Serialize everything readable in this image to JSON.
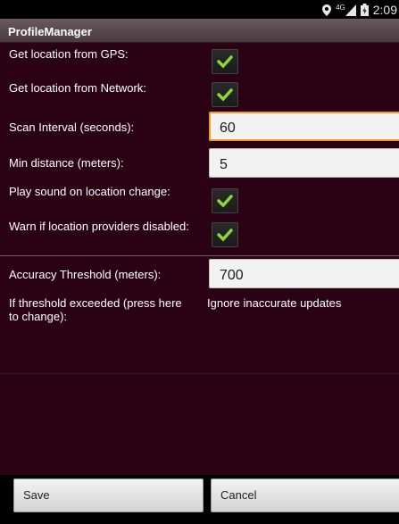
{
  "status_bar": {
    "time": "2:09",
    "network": "4G",
    "icons": [
      "location-icon",
      "signal-icon",
      "battery-icon"
    ]
  },
  "app_title": "ProfileManager",
  "settings": {
    "gps_label": "Get location from GPS:",
    "gps_checked": true,
    "network_label": "Get location from Network:",
    "network_checked": true,
    "scan_interval_label": "Scan Interval (seconds):",
    "scan_interval_value": "60",
    "min_distance_label": "Min distance (meters):",
    "min_distance_value": "5",
    "play_sound_label": "Play sound on location change:",
    "play_sound_checked": true,
    "warn_label": "Warn if location providers disabled:",
    "warn_checked": true,
    "accuracy_label": "Accuracy Threshold (meters):",
    "accuracy_value": "700",
    "threshold_action_label": "If threshold exceeded (press here to change):",
    "threshold_action_value": "Ignore inaccurate updates"
  },
  "buttons": {
    "save": "Save",
    "cancel": "Cancel"
  },
  "colors": {
    "background": "#2b0214",
    "title_bar": "#5a4a50",
    "check_mark": "#8ed43c",
    "focus_border": "#f39b1f"
  }
}
